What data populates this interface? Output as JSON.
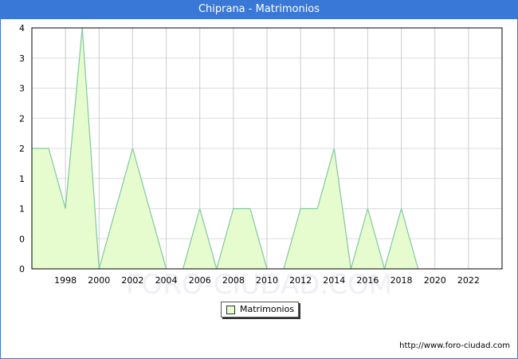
{
  "title": "Chiprana - Matrimonios",
  "footer": "http://www.foro-ciudad.com",
  "watermark": "FORO-CIUDAD.COM",
  "colors": {
    "title_bar": "#3a78d8",
    "fill": "#e6fccf",
    "line": "#80c89a"
  },
  "chart_data": {
    "type": "area",
    "title": "Chiprana - Matrimonios",
    "x": [
      1996,
      1997,
      1998,
      1999,
      2000,
      2001,
      2002,
      2003,
      2004,
      2005,
      2006,
      2007,
      2008,
      2009,
      2010,
      2011,
      2012,
      2013,
      2014,
      2015,
      2016,
      2017,
      2018,
      2019
    ],
    "series": [
      {
        "name": "Matrimonios",
        "values": [
          2,
          2,
          1,
          4,
          0,
          1,
          2,
          1,
          0,
          0,
          1,
          0,
          1,
          1,
          0,
          0,
          1,
          1,
          2,
          0,
          1,
          0,
          1,
          0
        ]
      }
    ],
    "xlim": [
      1996,
      2024
    ],
    "ylim": [
      0,
      4
    ],
    "x_ticks": [
      1998,
      2000,
      2002,
      2004,
      2006,
      2008,
      2010,
      2012,
      2014,
      2016,
      2018,
      2020,
      2022
    ],
    "y_ticks": [
      0,
      0.5,
      1,
      1.5,
      2,
      2.5,
      3,
      3.5,
      4
    ],
    "y_tick_labels": [
      "0",
      "0",
      "1",
      "1",
      "2",
      "2",
      "3",
      "3",
      "4"
    ],
    "grid": true,
    "legend": "bottom-center"
  }
}
